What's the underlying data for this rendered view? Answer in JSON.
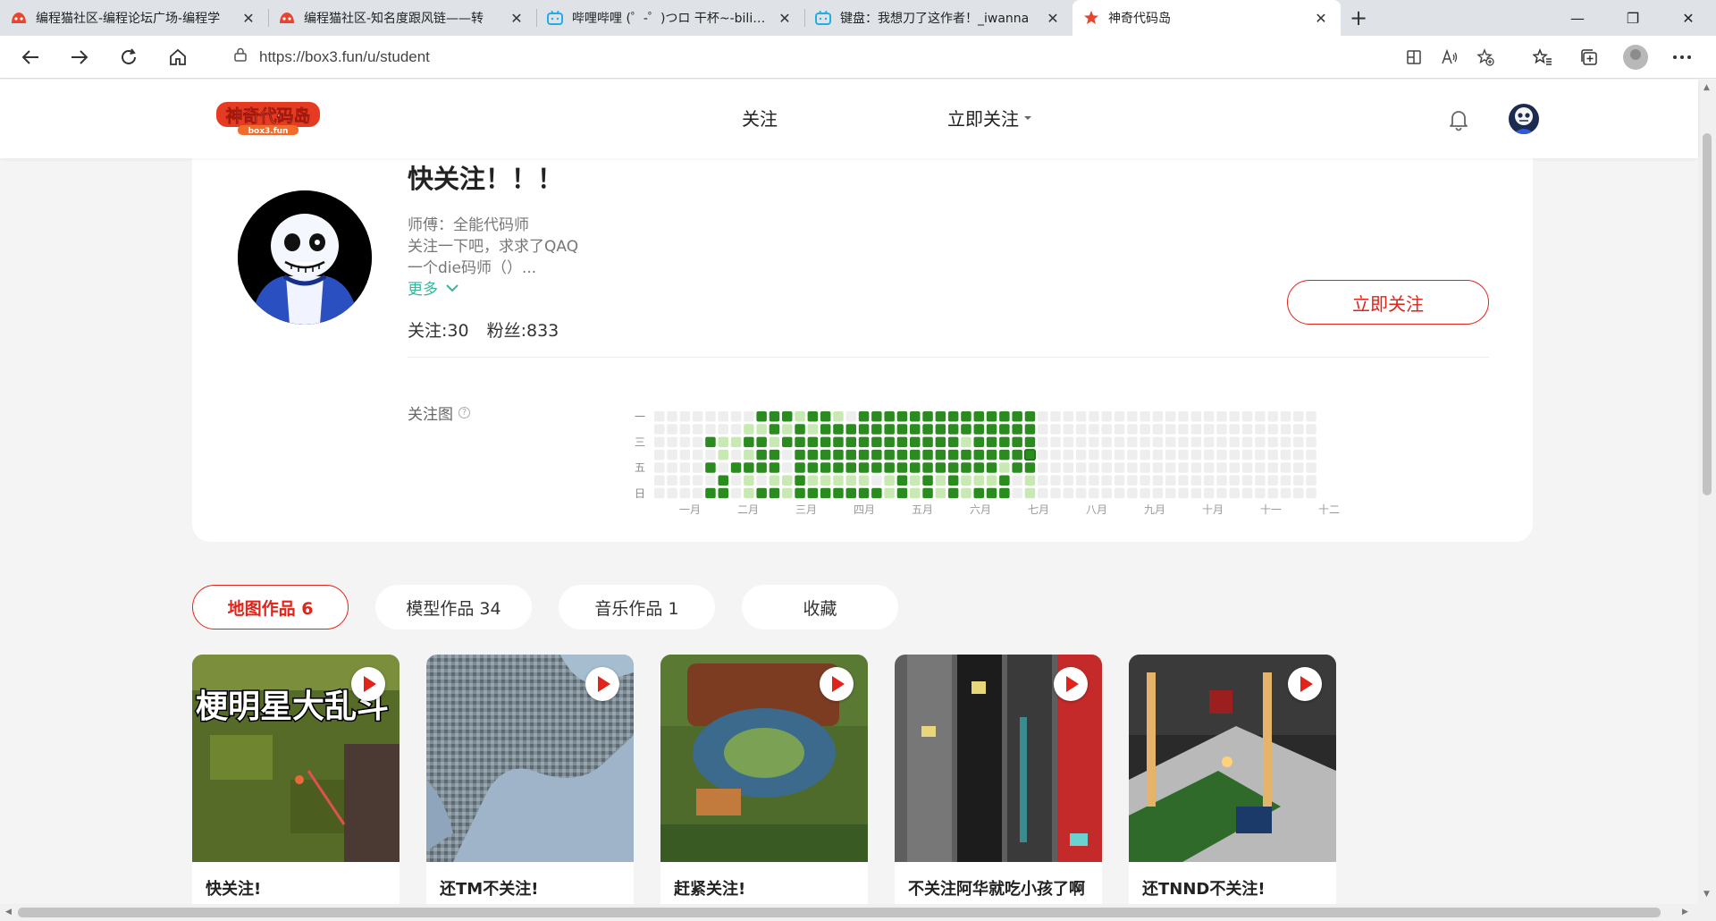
{
  "browser": {
    "tabs": [
      {
        "title": "编程猫社区-编程论坛广场-编程学",
        "favicon": "codemao-icon",
        "active": false
      },
      {
        "title": "编程猫社区-知名度跟风链——转",
        "favicon": "codemao-icon",
        "active": false
      },
      {
        "title": "哔哩哔哩 (゜-゜)つロ 干杯~-bilibili",
        "favicon": "bilibili-icon",
        "active": false
      },
      {
        "title": "键盘：我想刀了这作者！_iwanna",
        "favicon": "bilibili-icon",
        "active": false
      },
      {
        "title": "神奇代码岛",
        "favicon": "box3-icon",
        "active": true
      }
    ],
    "close_glyph": "✕",
    "new_tab_glyph": "+",
    "window": {
      "minimize": "—",
      "restore": "❐",
      "close": "✕"
    },
    "address": {
      "url": "https://box3.fun/u/student"
    }
  },
  "site": {
    "logo_text": "神奇代码岛",
    "logo_sub": "box3.fun",
    "nav": {
      "follow": "关注",
      "follow_now": "立即关注"
    }
  },
  "profile": {
    "name": "快关注！！！",
    "master": "师傅：全能代码师",
    "bio_line1": "关注一下吧，求求了QAQ",
    "bio_line2": "一个die码师（）...",
    "more": "更多",
    "following": "关注:30",
    "fans": "粉丝:833",
    "follow_button": "立即关注",
    "heatmap_label": "关注图",
    "help_glyph": "?"
  },
  "heatmap": {
    "weekday_labels": [
      "一",
      "",
      "三",
      "",
      "五",
      "",
      "日"
    ],
    "month_labels": [
      "一月",
      "二月",
      "三月",
      "四月",
      "五月",
      "六月",
      "七月",
      "八月",
      "九月",
      "十月",
      "十一",
      "十二"
    ],
    "colors": {
      "empty": "#eeeeee",
      "light": "#c9e9b4",
      "dark": "#2a8c1f",
      "border": "#1d6b16"
    },
    "level_rows": [
      "0000111001111111111111111000000000000000000000000000000",
      "0000111001111111111111111000000000000000000000000000000",
      "0000111001111111111111111000000000000000000000000000000",
      "0000111001111111111111111000000000000000000000000000000",
      "0000111001111111111111111000000000000000000000000000000",
      "0000111001111111111111111000000000000000000000000000000",
      "0000111001111111111111111000000000000000000000000000000"
    ],
    "pattern": [
      "00000000222122102222222222222200000000000000000000000000",
      "00000001121212222222222222222200000000000000000000000000",
      "00002112212222222222222212222200000000000000000000000000",
      "00000101220222222222222222222300000000000000000000000000",
      "00002022220222222222222222212200000000000000000000000000",
      "00000201011211111012121211120100000000000000000000000000",
      "00002201221222222212121212220100000000000000000000000000"
    ]
  },
  "tabs": [
    {
      "label": "地图作品 6",
      "active": true
    },
    {
      "label": "模型作品 34",
      "active": false
    },
    {
      "label": "音乐作品 1",
      "active": false
    },
    {
      "label": "收藏",
      "active": false
    }
  ],
  "works": [
    {
      "title": "快关注!",
      "overlay_text": "梗明星大乱斗"
    },
    {
      "title": "还TM不关注!"
    },
    {
      "title": "赶紧关注!"
    },
    {
      "title": "不关注阿华就吃小孩了啊"
    },
    {
      "title": "还TNND不关注!"
    }
  ]
}
